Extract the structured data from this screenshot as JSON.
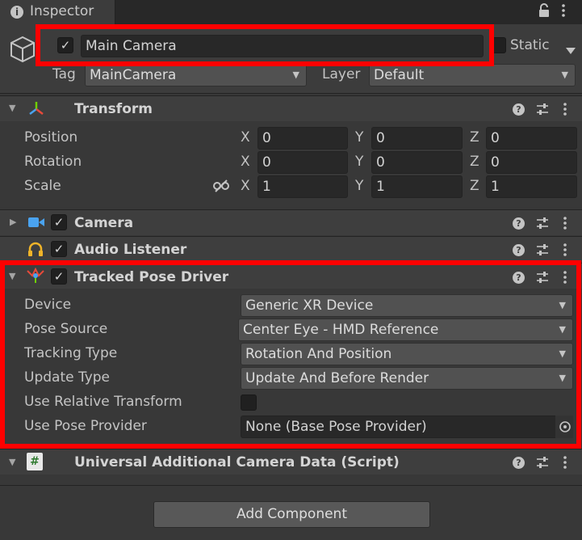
{
  "window": {
    "tab_label": "Inspector"
  },
  "gameobject": {
    "active": true,
    "name": "Main Camera",
    "static_label": "Static",
    "tag_label": "Tag",
    "tag_value": "MainCamera",
    "layer_label": "Layer",
    "layer_value": "Default"
  },
  "transform": {
    "title": "Transform",
    "rows": [
      {
        "label": "Position",
        "x": "0",
        "y": "0",
        "z": "0"
      },
      {
        "label": "Rotation",
        "x": "0",
        "y": "0",
        "z": "0"
      },
      {
        "label": "Scale",
        "x": "1",
        "y": "1",
        "z": "1"
      }
    ],
    "axis_x": "X",
    "axis_y": "Y",
    "axis_z": "Z"
  },
  "camera": {
    "title": "Camera"
  },
  "audio_listener": {
    "title": "Audio Listener"
  },
  "tracked_pose_driver": {
    "title": "Tracked Pose Driver",
    "device_label": "Device",
    "device_value": "Generic XR Device",
    "pose_source_label": "Pose Source",
    "pose_source_value": "Center Eye - HMD Reference",
    "tracking_type_label": "Tracking Type",
    "tracking_type_value": "Rotation And Position",
    "update_type_label": "Update Type",
    "update_type_value": "Update And Before Render",
    "use_relative_label": "Use Relative Transform",
    "use_relative_checked": false,
    "use_pose_provider_label": "Use Pose Provider",
    "use_pose_provider_value": "None (Base Pose Provider)"
  },
  "urp_camera_data": {
    "title": "Universal Additional Camera Data (Script)"
  },
  "add_component_label": "Add Component",
  "colors": {
    "highlight": "#ff0000",
    "background": "#383838",
    "camera_icon": "#4aa3f0",
    "audio_icon": "#f0b429"
  }
}
